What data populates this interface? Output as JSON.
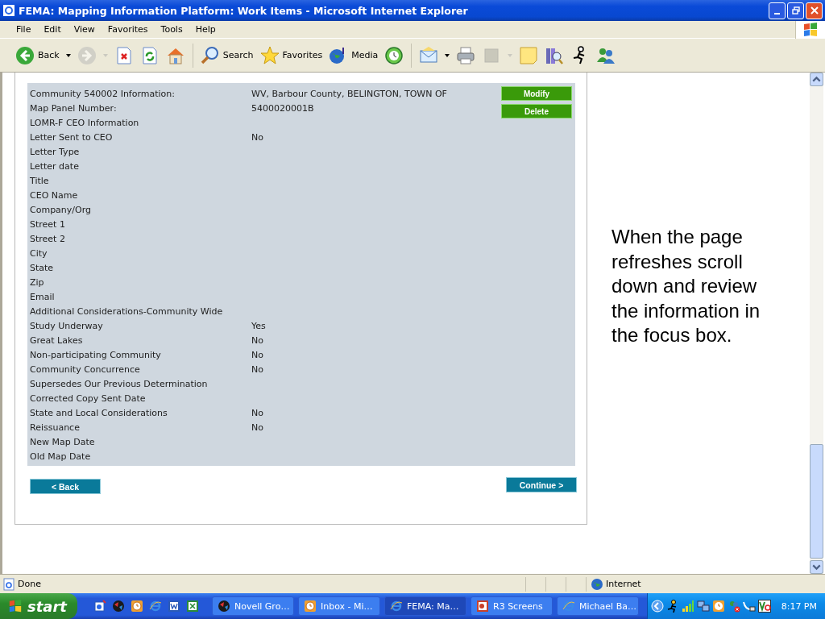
{
  "window": {
    "title": "FEMA: Mapping Information Platform: Work Items - Microsoft Internet Explorer"
  },
  "menu": [
    "File",
    "Edit",
    "View",
    "Favorites",
    "Tools",
    "Help"
  ],
  "toolbar": [
    {
      "kind": "back",
      "label": "Back",
      "dropdown": true,
      "disabled": false
    },
    {
      "kind": "forward",
      "dropdown": true,
      "disabled": true
    },
    {
      "kind": "stop",
      "disabled": false
    },
    {
      "kind": "refresh",
      "disabled": false
    },
    {
      "kind": "home",
      "disabled": false
    },
    {
      "kind": "separator"
    },
    {
      "kind": "search",
      "label": "Search",
      "disabled": false
    },
    {
      "kind": "favorites",
      "label": "Favorites",
      "disabled": false
    },
    {
      "kind": "media",
      "label": "Media",
      "disabled": false
    },
    {
      "kind": "history",
      "disabled": false
    },
    {
      "kind": "separator"
    },
    {
      "kind": "mail",
      "dropdown": true,
      "disabled": false
    },
    {
      "kind": "print",
      "disabled": false
    },
    {
      "kind": "edit",
      "dropdown": true,
      "disabled": true
    },
    {
      "kind": "note",
      "disabled": false
    },
    {
      "kind": "research",
      "disabled": false
    },
    {
      "kind": "runner",
      "disabled": false
    },
    {
      "kind": "messenger",
      "disabled": false
    }
  ],
  "details": [
    {
      "label": "Community 540002 Information:",
      "value": "WV, Barbour County, BELINGTON, TOWN OF"
    },
    {
      "label": "Map Panel Number:",
      "value": "5400020001B"
    },
    {
      "label": "LOMR-F CEO Information"
    },
    {
      "label": "Letter Sent to CEO",
      "value": "No"
    },
    {
      "label": "Letter Type"
    },
    {
      "label": "Letter date"
    },
    {
      "label": "Title"
    },
    {
      "label": "CEO Name"
    },
    {
      "label": "Company/Org"
    },
    {
      "label": "Street 1"
    },
    {
      "label": "Street 2"
    },
    {
      "label": "City"
    },
    {
      "label": "State"
    },
    {
      "label": "Zip"
    },
    {
      "label": "Email"
    },
    {
      "label": "Additional Considerations-Community Wide"
    },
    {
      "label": "Study Underway",
      "value": "Yes"
    },
    {
      "label": "Great Lakes",
      "value": "No"
    },
    {
      "label": "Non-participating Community",
      "value": "No"
    },
    {
      "label": "Community Concurrence",
      "value": "No"
    },
    {
      "label": "Supersedes Our Previous Determination"
    },
    {
      "label": "Corrected Copy Sent Date"
    },
    {
      "label": "State and Local Considerations",
      "value": "No"
    },
    {
      "label": "Reissuance",
      "value": "No"
    },
    {
      "label": "New Map Date"
    },
    {
      "label": "Old Map Date"
    }
  ],
  "panel_buttons": [
    "Modify",
    "Delete"
  ],
  "nav": {
    "back": "< Back",
    "continue": "Continue >"
  },
  "annotation": "When the page refreshes scroll down and review the information in the focus box.",
  "status_bar": {
    "text": "Done",
    "zone": "Internet"
  },
  "taskbar": {
    "start": "start",
    "tasks": [
      {
        "label": "Novell Gro…",
        "selected": false
      },
      {
        "label": "Inbox - Mi…",
        "selected": false
      },
      {
        "label": "FEMA: Ma…",
        "selected": true
      },
      {
        "label": "R3 Screens",
        "selected": false
      },
      {
        "label": "Michael Ba…",
        "selected": false
      }
    ],
    "time": "8:17 PM"
  }
}
